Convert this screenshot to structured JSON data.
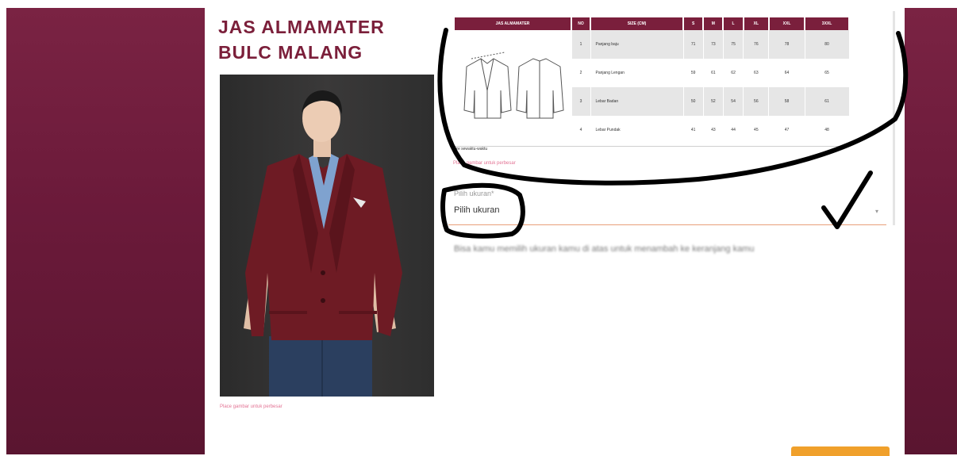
{
  "product": {
    "title": "JAS ALMAMATER BULC MALANG",
    "zoom_hint_photo": "Place gambar untuk perbesar",
    "zoom_hint_chart": "Place gambar untuk perbesar"
  },
  "size_chart": {
    "header": [
      "JAS ALMAMATER",
      "NO",
      "SIZE (CM)",
      "S",
      "M",
      "L",
      "XL",
      "XXL",
      "3XXL"
    ],
    "rows": [
      {
        "no": "1",
        "label": "Panjang baju",
        "values": [
          "71",
          "73",
          "75",
          "76",
          "78",
          "80"
        ]
      },
      {
        "no": "2",
        "label": "Panjang Lengan",
        "values": [
          "59",
          "61",
          "62",
          "63",
          "64",
          "65"
        ]
      },
      {
        "no": "3",
        "label": "Lebar Badan",
        "values": [
          "50",
          "52",
          "54",
          "56",
          "58",
          "61"
        ]
      },
      {
        "no": "4",
        "label": "Lebar Pundak",
        "values": [
          "41",
          "43",
          "44",
          "45",
          "47",
          "48"
        ]
      }
    ],
    "note": "Size sewaktu-waktu"
  },
  "size_select": {
    "label": "Pilih ukuran*",
    "value": "Pilih ukuran"
  },
  "blurred_notice": "Bisa kamu memilih ukuran kamu di atas untuk menambah ke keranjang kamu",
  "colors": {
    "brand": "#7b1f3a",
    "accent": "#f0a02b",
    "link": "#e37394"
  },
  "icons": [
    "chevron-down-icon"
  ]
}
